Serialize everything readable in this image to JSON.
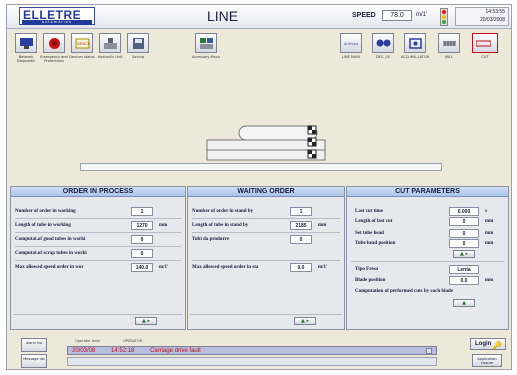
{
  "header": {
    "logo_main": "ELLETRE",
    "logo_sub": "automation",
    "title": "LINE",
    "speed_label": "SPEED",
    "speed_value": "78.0",
    "speed_unit": "m/1'",
    "time": "14:53:55",
    "date": "20/03/2008"
  },
  "toolbar": {
    "left": [
      {
        "label": "Network Diagnostic",
        "icon": "network-icon"
      },
      {
        "label": "Emergency and Protections",
        "icon": "emergency-icon"
      },
      {
        "label": "Devices status",
        "icon": "devices-icon"
      },
      {
        "label": "Hydraulic Unit",
        "icon": "hydraulic-icon"
      },
      {
        "label": "Saving",
        "icon": "saving-icon"
      },
      {
        "label": "Accessory Menu",
        "icon": "accessory-icon"
      }
    ],
    "right": [
      {
        "label": "LINE MAIN",
        "icon": "line-main-icon"
      },
      {
        "label": "DEC. J/S",
        "icon": "decoiler-icon"
      },
      {
        "label": "ACCUMU-LATOR",
        "icon": "accumulator-icon"
      },
      {
        "label": "MILL",
        "icon": "mill-icon"
      },
      {
        "label": "CUT",
        "icon": "cut-icon"
      }
    ]
  },
  "order_in_process": {
    "title": "ORDER IN PROCESS",
    "rows": [
      {
        "label": "Number of order in working",
        "value": "1",
        "unit": ""
      },
      {
        "label": "Length of tube in working",
        "value": "1270",
        "unit": "mm"
      },
      {
        "label": "Computat.of good tubes in worki",
        "value": "0",
        "unit": ""
      },
      {
        "label": "Computat.of scrap tubes in worki",
        "value": "0",
        "unit": ""
      },
      {
        "label": "Max allowed speed order in wor",
        "value": "140.0",
        "unit": "m/1'"
      }
    ]
  },
  "waiting_order": {
    "title": "WAITING ORDER",
    "rows": [
      {
        "label": "Number of order in stand by",
        "value": "1",
        "unit": ""
      },
      {
        "label": "Length of tube in stand by",
        "value": "2185",
        "unit": "mm"
      },
      {
        "label": "Tubi da produrre",
        "value": "0",
        "unit": ""
      },
      {
        "label": "Max allowed speed order in sta",
        "value": "0.0",
        "unit": "m/1'"
      }
    ]
  },
  "cut_parameters": {
    "title": "CUT PARAMETERS",
    "rows": [
      {
        "label": "Last cut time",
        "value": "0.000",
        "unit": "s"
      },
      {
        "label": "Length of last cut",
        "value": "0",
        "unit": "mm"
      },
      {
        "label": "Set tube head",
        "value": "0",
        "unit": "mm"
      },
      {
        "label": "Tube head position",
        "value": "0",
        "unit": "mm"
      }
    ],
    "tipo_fresa_label": "Tipo Fresa",
    "tipo_fresa_value": "Lenta",
    "blade_label": "Blade position",
    "blade_value": "0.0",
    "blade_unit": "mm",
    "computation_label": "Computation of performed cuts by each blade"
  },
  "footer": {
    "alarm_button": "Alarm list",
    "message_button": "Message list",
    "operator_level_label": "Operator level",
    "operator_level_value": "OPERATOR",
    "alarm_date": "20/03/08",
    "alarm_time": "14:52:18",
    "alarm_text": "Carriage drive fault",
    "login_label": "Login",
    "app_close_label": "Application closure"
  },
  "colors": {
    "accent_blue": "#1f3a9a",
    "alarm_red": "#c01010",
    "panel_head": "#a9c4ea"
  }
}
